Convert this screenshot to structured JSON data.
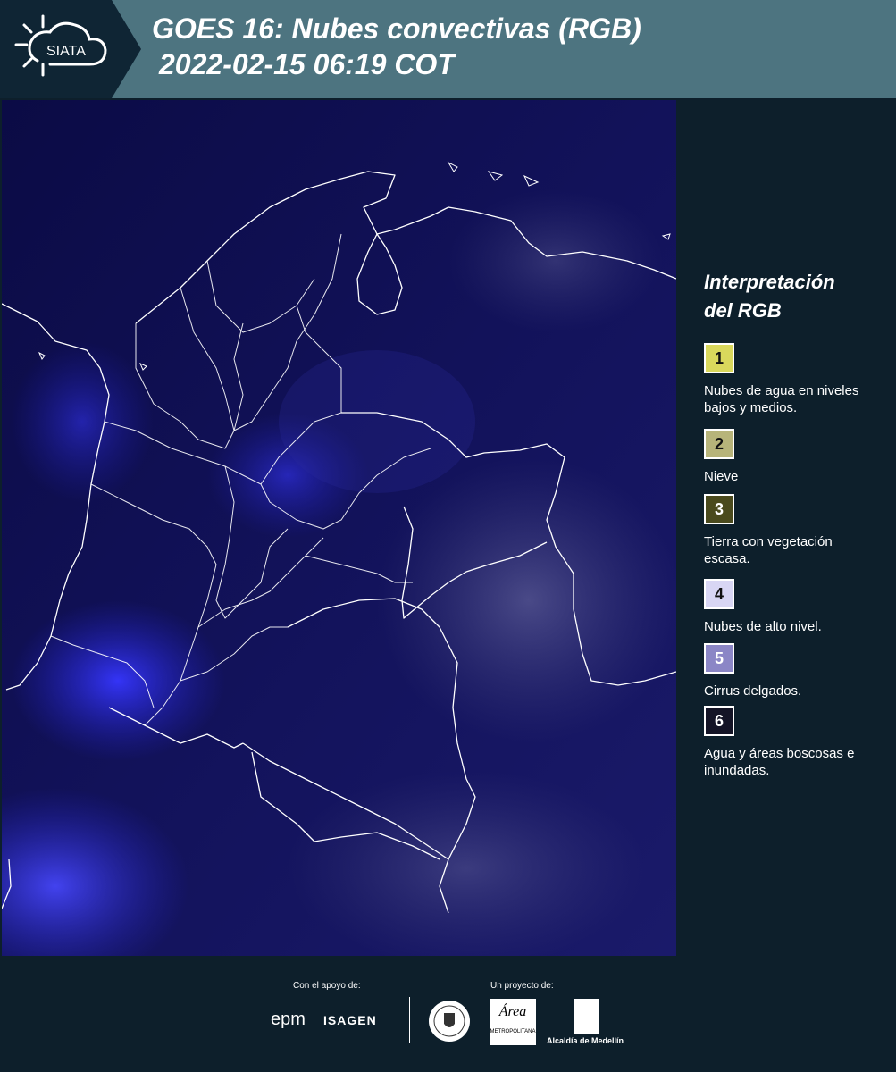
{
  "header": {
    "logo_text": "SIATA",
    "title_line1": "GOES 16: Nubes convectivas (RGB)",
    "title_line2": "2022-02-15 06:19 COT"
  },
  "legend": {
    "title_line1": "Interpretación",
    "title_line2": "del RGB",
    "items": [
      {
        "number": "1",
        "color": "#d9d85c",
        "label": "Nubes de agua en niveles bajos y medios."
      },
      {
        "number": "2",
        "color": "#b7b47a",
        "label": "Nieve"
      },
      {
        "number": "3",
        "color": "#4a4a1d",
        "label": "Tierra con vegetación escasa."
      },
      {
        "number": "4",
        "color": "#d8d6f4",
        "label": "Nubes de alto nivel."
      },
      {
        "number": "5",
        "color": "#8b86c6",
        "label": "Cirrus delgados."
      },
      {
        "number": "6",
        "color": "#141426",
        "label": "Agua y áreas boscosas e inundadas."
      }
    ]
  },
  "footer": {
    "support_label": "Con el apoyo de:",
    "project_label": "Un proyecto de:",
    "epm": "epm",
    "isagen": "ISAGEN",
    "area_logo_text": "Área",
    "area_logo_sub": "METROPOLITANA",
    "alcaldia": "Alcaldía de Medellín"
  },
  "colors": {
    "header_bg": "#4d7480",
    "page_bg": "#0d1f2b",
    "map_base": "#0a0a3a",
    "map_bright": "#2f2ff0",
    "boundary": "#ffffff"
  }
}
